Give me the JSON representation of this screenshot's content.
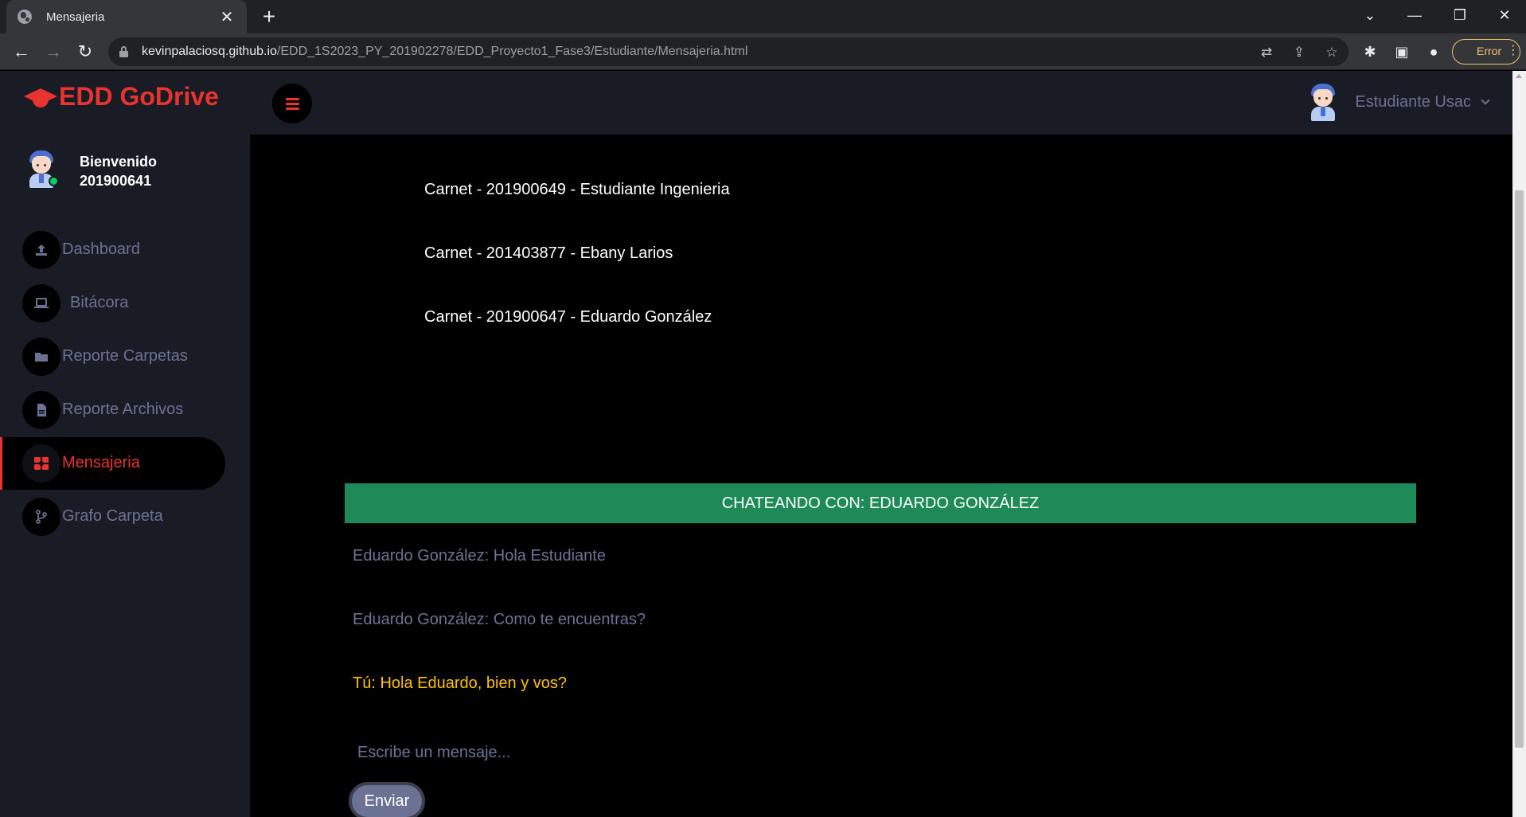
{
  "browser": {
    "tab_title": "Mensajeria",
    "url_host": "kevinpalaciosq.github.io",
    "url_path": "/EDD_1S2023_PY_201902278/EDD_Proyecto1_Fase3/Estudiante/Mensajeria.html",
    "error_label": "Error"
  },
  "topnav": {
    "brand": "EDD GoDrive",
    "user_name": "Estudiante Usac"
  },
  "sidebar": {
    "welcome": "Bienvenido",
    "user_id": "201900641",
    "items": [
      {
        "label": "Dashboard",
        "icon": "upload-icon"
      },
      {
        "label": "Bitácora",
        "icon": "laptop-icon"
      },
      {
        "label": "Reporte Carpetas",
        "icon": "folder-icon"
      },
      {
        "label": "Reporte Archivos",
        "icon": "file-icon"
      },
      {
        "label": "Mensajeria",
        "icon": "messages-icon",
        "active": true
      },
      {
        "label": "Grafo Carpeta",
        "icon": "graph-icon"
      }
    ]
  },
  "contacts": [
    "Carnet - 201900649 - Estudiante Ingenieria",
    "Carnet - 201403877 - Ebany Larios",
    "Carnet - 201900647 - Eduardo González"
  ],
  "chat": {
    "header": "CHATEANDO CON: EDUARDO GONZÁLEZ",
    "messages": [
      {
        "text": "Eduardo González: Hola Estudiante",
        "mine": false
      },
      {
        "text": "Eduardo González: Como te encuentras?",
        "mine": false
      },
      {
        "text": "Tú: Hola Eduardo, bien y vos?",
        "mine": true
      }
    ],
    "input_placeholder": "Escribe un mensaje...",
    "send_label": "Enviar"
  },
  "colors": {
    "brand_red": "#e8332f",
    "sidebar_bg": "#191c24",
    "chat_header_green": "#1e8a57",
    "muted_text": "#6c7293",
    "own_message": "#ffc107",
    "online": "#00d25b"
  }
}
